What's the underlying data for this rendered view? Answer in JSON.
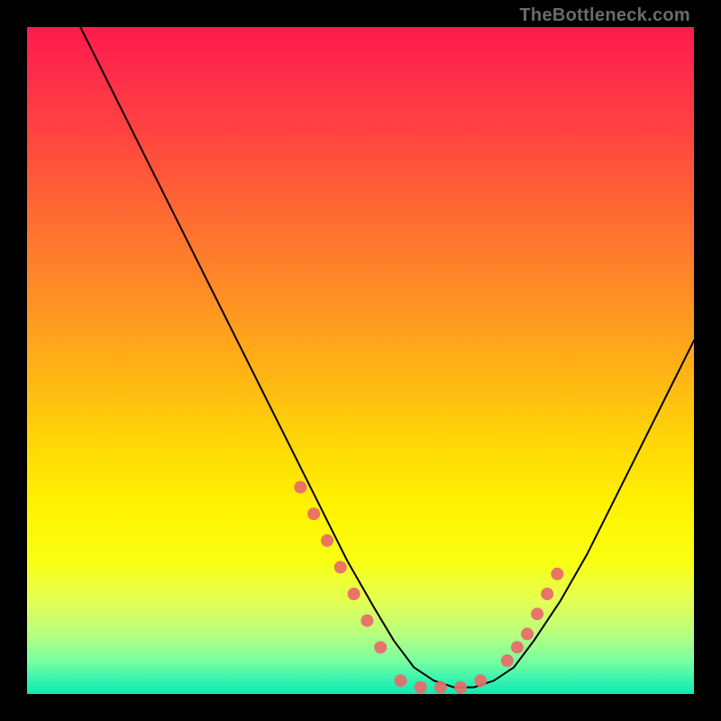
{
  "watermark_text": "TheBottleneck.com",
  "chart_data": {
    "type": "line",
    "title": "",
    "xlabel": "",
    "ylabel": "",
    "xlim": [
      0,
      100
    ],
    "ylim": [
      0,
      100
    ],
    "grid": false,
    "legend_position": "none",
    "series": [
      {
        "name": "main-curve",
        "color": "#000000",
        "x": [
          8,
          12,
          16,
          20,
          24,
          28,
          32,
          36,
          40,
          44,
          48,
          52,
          55,
          58,
          61,
          64,
          67,
          70,
          73,
          76,
          80,
          84,
          88,
          92,
          96,
          100
        ],
        "y": [
          100,
          92,
          84,
          76,
          68,
          60,
          52,
          44,
          36,
          28,
          20,
          13,
          8,
          4,
          2,
          1,
          1,
          2,
          4,
          8,
          14,
          21,
          29,
          37,
          45,
          53
        ]
      },
      {
        "name": "left-dots",
        "color": "#e86a6a",
        "type": "scatter",
        "x": [
          41,
          43,
          45,
          47,
          49,
          51,
          53
        ],
        "y": [
          31,
          27,
          23,
          19,
          15,
          11,
          7
        ]
      },
      {
        "name": "bottom-dots",
        "color": "#e86a6a",
        "type": "scatter",
        "x": [
          56,
          59,
          62,
          65,
          68
        ],
        "y": [
          2,
          1,
          1,
          1,
          2
        ]
      },
      {
        "name": "right-dots",
        "color": "#e86a6a",
        "type": "scatter",
        "x": [
          72,
          73.5,
          75,
          76.5,
          78,
          79.5
        ],
        "y": [
          5,
          7,
          9,
          12,
          15,
          18
        ]
      }
    ]
  }
}
